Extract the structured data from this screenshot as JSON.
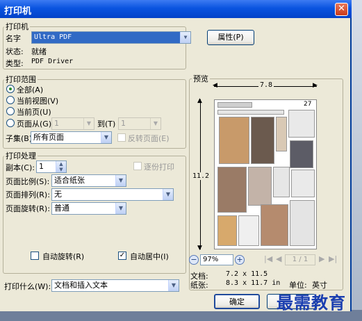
{
  "dialog": {
    "title": "打印机",
    "close_glyph": "✕"
  },
  "printer": {
    "group_label": "打印机",
    "name_label": "名字",
    "name_value": "Ultra PDF",
    "properties_button": "属性(P)",
    "status_label": "状态:",
    "status_value": "就绪",
    "type_label": "类型:",
    "type_value": "PDF Driver"
  },
  "range": {
    "group_label": "打印范围",
    "all": "全部(A)",
    "current_view": "当前视图(V)",
    "current_page": "当前页(U)",
    "pages_from": "页面从(G)",
    "from_value": "1",
    "to_label": "到(T)",
    "to_value": "1",
    "subset_label": "子集(B)",
    "subset_value": "所有页面",
    "reverse_label": "反转页面(E)"
  },
  "handling": {
    "group_label": "打印处理",
    "copies_label": "副本(C):",
    "copies_value": "1",
    "collate_label": "逐份打印",
    "page_scale_label": "页面比例(S):",
    "page_scale_value": "适合纸张",
    "page_order_label": "页面排列(R):",
    "page_order_value": "无",
    "page_rotate_label": "页面旋转(R):",
    "page_rotate_value": "普通",
    "auto_rotate_label": "自动旋转(R)",
    "auto_center_label": "自动居中(I)"
  },
  "print_what": {
    "label": "打印什么(W):",
    "value": "文档和插入文本"
  },
  "preview": {
    "group_label": "预览",
    "width_dim": "7.8",
    "height_dim": "11.2",
    "page_number": "27",
    "zoom_value": "97%",
    "page_field": "1 / 1",
    "doc_label": "文档:",
    "doc_size": "7.2 x 11.5",
    "paper_label": "纸张:",
    "paper_size": "8.3 x 11.7 in",
    "unit_label": "单位:",
    "unit_value": "英寸"
  },
  "ok_button": "确定",
  "watermark": "最需教育"
}
